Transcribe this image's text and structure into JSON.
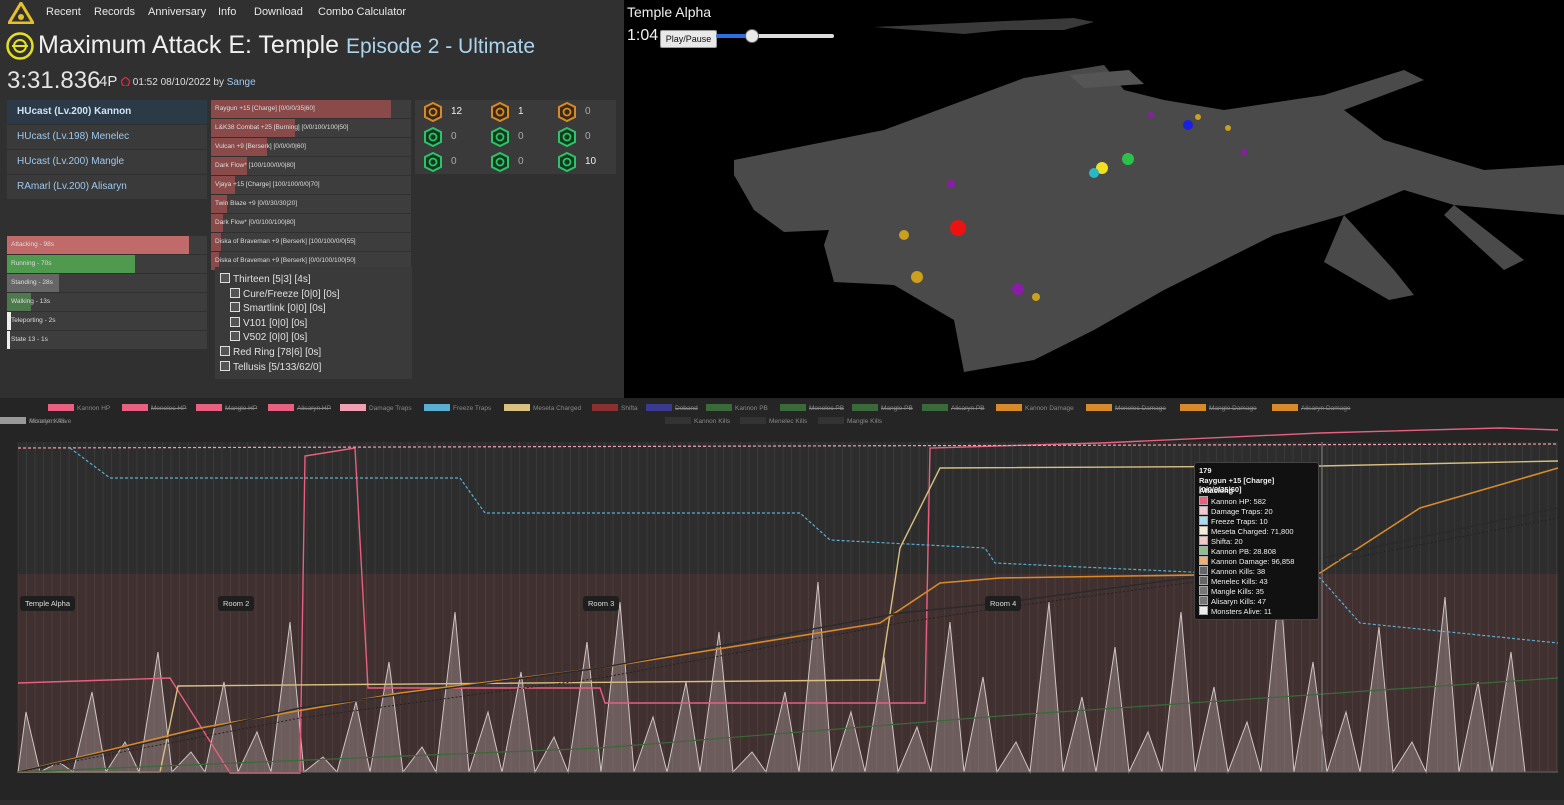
{
  "nav": {
    "items": [
      "Recent",
      "Records",
      "Anniversary",
      "Info",
      "Download",
      "Combo Calculator"
    ]
  },
  "header": {
    "title": "Maximum Attack E: Temple",
    "subtitle": "Episode 2 - Ultimate",
    "time": "3:31.836",
    "players": "4P",
    "date": "01:52 08/10/2022",
    "by": "by",
    "user": "Sange"
  },
  "party": [
    {
      "label": "HUcast (Lv.200) Kannon",
      "active": true
    },
    {
      "label": "HUcast (Lv.198) Menelec",
      "active": false
    },
    {
      "label": "HUcast (Lv.200) Mangle",
      "active": false
    },
    {
      "label": "RAmarl (Lv.200) Alisaryn",
      "active": false
    }
  ],
  "weapons": [
    {
      "label": "Raygun +15 [Charge] [0/0/0/35|60]",
      "fraction": 0.9
    },
    {
      "label": "L&K38 Combat +25 [Burning] [0/0/100/100|50]",
      "fraction": 0.42
    },
    {
      "label": "Vulcan +9 [Berserk] [0/0/0/0|60]",
      "fraction": 0.28
    },
    {
      "label": "Dark Flow* [100/100/0/0|80]",
      "fraction": 0.18
    },
    {
      "label": "Vjaya +15 [Charge] [100/100/0/0|70]",
      "fraction": 0.12
    },
    {
      "label": "Twin Blaze +9 [0/0/30/30|20]",
      "fraction": 0.08
    },
    {
      "label": "Dark Flow* [0/0/100/100|80]",
      "fraction": 0.06
    },
    {
      "label": "Diska of Braveman +9 [Berserk] [100/100/0/0|55]",
      "fraction": 0.05
    },
    {
      "label": "Diska of Braveman +9 [Berserk] [0/0/100/100|50]",
      "fraction": 0.04
    }
  ],
  "states": [
    {
      "label": "Attacking - 98s",
      "fraction": 0.91,
      "color": "#c06a6a"
    },
    {
      "label": "Running - 70s",
      "fraction": 0.64,
      "color": "#4f9a4f"
    },
    {
      "label": "Standing - 28s",
      "fraction": 0.26,
      "color": "#666666"
    },
    {
      "label": "Walking - 13s",
      "fraction": 0.12,
      "color": "#4c7a4c"
    },
    {
      "label": "Teleporting - 2s",
      "fraction": 0.02,
      "color": "#eeeeee"
    },
    {
      "label": "State 13 - 1s",
      "fraction": 0.01,
      "color": "#eeeeee"
    }
  ],
  "counters": [
    {
      "icon": "orange-trap-icon",
      "value": "12"
    },
    {
      "icon": "orange-trap-icon",
      "value": "1"
    },
    {
      "icon": "orange-trap-icon",
      "value": "0"
    },
    {
      "icon": "green-trap-icon",
      "value": "0"
    },
    {
      "icon": "green-trap-icon",
      "value": "0"
    },
    {
      "icon": "green-trap-icon",
      "value": "0"
    },
    {
      "icon": "green-trap-icon",
      "value": "0"
    },
    {
      "icon": "green-trap-icon",
      "value": "0"
    },
    {
      "icon": "green-trap-icon",
      "value": "10"
    }
  ],
  "items": [
    {
      "label": "Thirteen [5|3] [4s]",
      "indent": 0
    },
    {
      "label": "Cure/Freeze [0|0] [0s]",
      "indent": 1
    },
    {
      "label": "Smartlink [0|0] [0s]",
      "indent": 1
    },
    {
      "label": "V101 [0|0] [0s]",
      "indent": 1
    },
    {
      "label": "V502 [0|0] [0s]",
      "indent": 1
    },
    {
      "label": "Red Ring [78|6] [0s]",
      "indent": 0
    },
    {
      "label": "Tellusis [5/133/62/0]",
      "indent": 0
    }
  ],
  "map": {
    "title": "Temple Alpha",
    "time": "1:04",
    "play_label": "Play/Pause",
    "progress": 0.3
  },
  "chart_legend": [
    {
      "label": "Kannon HP",
      "color": "#e85f80",
      "off": false
    },
    {
      "label": "Menelec HP",
      "color": "#e85f80",
      "off": true
    },
    {
      "label": "Mangle HP",
      "color": "#e85f80",
      "off": true
    },
    {
      "label": "Alisaryn HP",
      "color": "#e85f80",
      "off": true
    },
    {
      "label": "Damage Traps",
      "color": "#f0a0b0",
      "off": false
    },
    {
      "label": "Freeze Traps",
      "color": "#5aaed0",
      "off": false
    },
    {
      "label": "Meseta Charged",
      "color": "#d8c080",
      "off": false
    },
    {
      "label": "Shifta",
      "color": "#8a3030",
      "off": false
    },
    {
      "label": "Deband",
      "color": "#3a3a90",
      "off": true
    },
    {
      "label": "Kannon PB",
      "color": "#3a6a3a",
      "off": false
    },
    {
      "label": "Menelec PB",
      "color": "#3a6a3a",
      "off": true
    },
    {
      "label": "Mangle PB",
      "color": "#3a6a3a",
      "off": true
    },
    {
      "label": "Alisaryn PB",
      "color": "#3a6a3a",
      "off": true
    },
    {
      "label": "Kannon Damage",
      "color": "#d88a2a",
      "off": false
    },
    {
      "label": "Menelec Damage",
      "color": "#d88a2a",
      "off": true
    },
    {
      "label": "Mangle Damage",
      "color": "#d88a2a",
      "off": true
    },
    {
      "label": "Alisaryn Damage",
      "color": "#d88a2a",
      "off": true
    },
    {
      "label": "Kannon Kills",
      "color": "#333333",
      "off": false
    },
    {
      "label": "Menelec Kills",
      "color": "#333333",
      "off": false
    },
    {
      "label": "Mangle Kills",
      "color": "#333333",
      "off": false
    },
    {
      "label": "Alisaryn Kills",
      "color": "#333333",
      "off": false
    },
    {
      "label": "Monsters Alive",
      "color": "#999999",
      "off": false
    }
  ],
  "rooms": [
    "Temple Alpha",
    "Room 2",
    "Room 3",
    "Room 4"
  ],
  "tooltip": {
    "title": "179",
    "weapon": "Raygun +15 [Charge] [0/0/0/35|60]",
    "state": "Attacking",
    "lines": [
      {
        "label": "Kannon HP: 582",
        "color": "#e85f80"
      },
      {
        "label": "Damage Traps: 20",
        "color": "#f5c8d0"
      },
      {
        "label": "Freeze Traps: 10",
        "color": "#a8dcf0"
      },
      {
        "label": "Meseta Charged: 71,800",
        "color": "#f5ecd5"
      },
      {
        "label": "Shifta: 20",
        "color": "#f2c8c8"
      },
      {
        "label": "Kannon PB: 28.808",
        "color": "#8fbf8f"
      },
      {
        "label": "Kannon Damage: 96,858",
        "color": "#f0b070"
      },
      {
        "label": "Kannon Kills: 38",
        "color": "#666666"
      },
      {
        "label": "Menelec Kills: 43",
        "color": "#666666"
      },
      {
        "label": "Mangle Kills: 35",
        "color": "#777777"
      },
      {
        "label": "Alisaryn Kills: 47",
        "color": "#777777"
      },
      {
        "label": "Monsters Alive: 11",
        "color": "#eeeeee"
      }
    ]
  }
}
